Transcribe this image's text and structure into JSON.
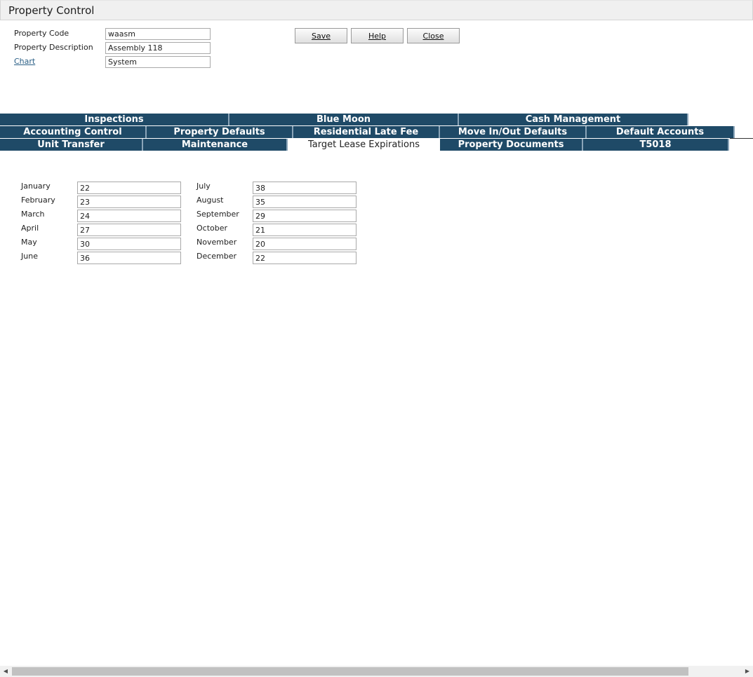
{
  "header": {
    "title": "Property Control"
  },
  "form": {
    "property_code_label": "Property Code",
    "property_code_value": "waasm",
    "property_description_label": "Property Description",
    "property_description_value": "Assembly 118",
    "chart_link": "Chart",
    "chart_value": "System"
  },
  "buttons": {
    "save": "Save",
    "help": "Help",
    "close": "Close"
  },
  "tabs": {
    "row1": [
      "Inspections",
      "Blue Moon",
      "Cash Management"
    ],
    "row2": [
      "Accounting Control",
      "Property Defaults",
      "Residential Late Fee",
      "Move In/Out Defaults",
      "Default Accounts"
    ],
    "row3": [
      "Unit Transfer",
      "Maintenance",
      "Target Lease Expirations",
      "Property Documents",
      "T5018"
    ]
  },
  "months": [
    {
      "label": "January",
      "value": "22"
    },
    {
      "label": "February",
      "value": "23"
    },
    {
      "label": "March",
      "value": "24"
    },
    {
      "label": "April",
      "value": "27"
    },
    {
      "label": "May",
      "value": "30"
    },
    {
      "label": "June",
      "value": "36"
    },
    {
      "label": "July",
      "value": "38"
    },
    {
      "label": "August",
      "value": "35"
    },
    {
      "label": "September",
      "value": "29"
    },
    {
      "label": "October",
      "value": "21"
    },
    {
      "label": "November",
      "value": "20"
    },
    {
      "label": "December",
      "value": "22"
    }
  ],
  "icons": {
    "scroll_left": "chevron-left-icon",
    "scroll_right": "chevron-right-icon"
  }
}
